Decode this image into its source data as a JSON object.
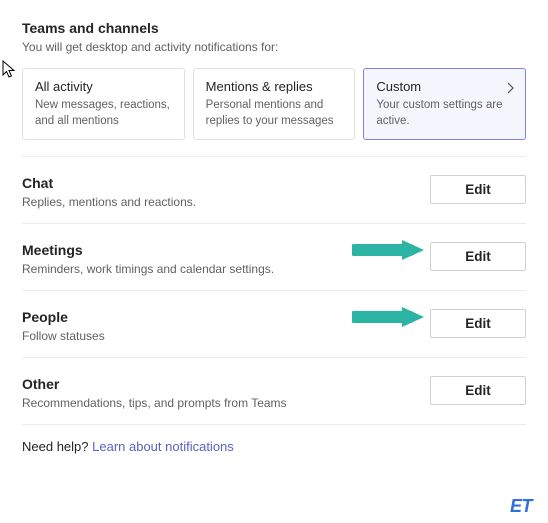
{
  "teamsChannels": {
    "title": "Teams and channels",
    "subtitle": "You will get desktop and activity notifications for:",
    "cards": {
      "allActivity": {
        "title": "All activity",
        "desc": "New messages, reactions, and all mentions"
      },
      "mentions": {
        "title": "Mentions & replies",
        "desc": "Personal mentions and replies to your messages"
      },
      "custom": {
        "title": "Custom",
        "desc": "Your custom settings are active."
      }
    }
  },
  "sections": {
    "chat": {
      "title": "Chat",
      "desc": "Replies, mentions and reactions.",
      "button": "Edit"
    },
    "meetings": {
      "title": "Meetings",
      "desc": "Reminders, work timings and calendar settings.",
      "button": "Edit"
    },
    "people": {
      "title": "People",
      "desc": "Follow statuses",
      "button": "Edit"
    },
    "other": {
      "title": "Other",
      "desc": "Recommendations, tips, and prompts from Teams",
      "button": "Edit"
    }
  },
  "help": {
    "prefix": "Need help? ",
    "link": "Learn about notifications"
  },
  "brand": "ET"
}
